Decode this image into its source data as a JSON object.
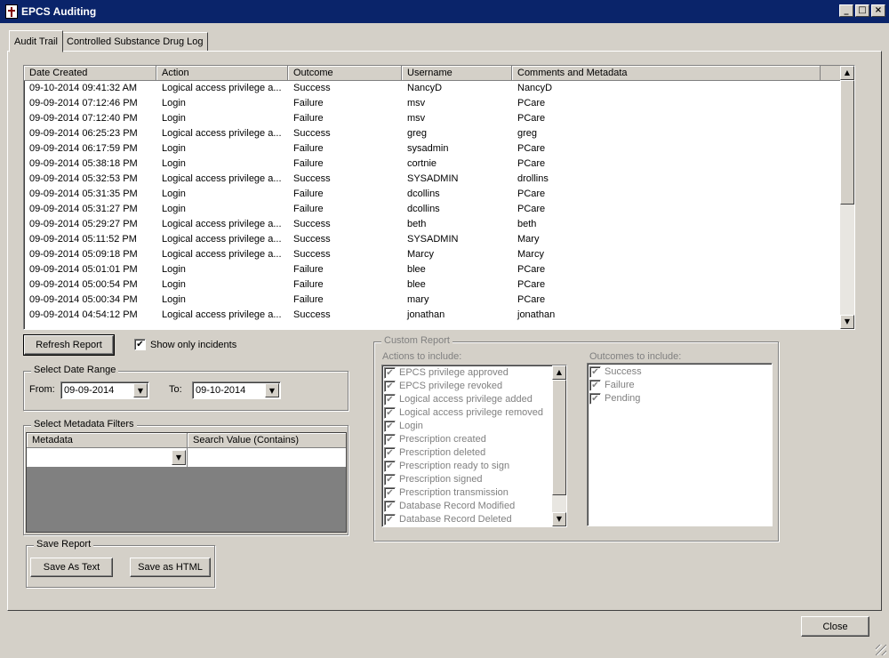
{
  "window": {
    "title": "EPCS Auditing",
    "controls": {
      "minimize": "_",
      "maximize": "□",
      "close": "×"
    }
  },
  "tabs": [
    {
      "label": "Audit Trail",
      "active": true
    },
    {
      "label": "Controlled Substance Drug Log",
      "active": false
    }
  ],
  "grid": {
    "columns": [
      "Date Created",
      "Action",
      "Outcome",
      "Username",
      "Comments and Metadata"
    ],
    "rows": [
      [
        "09-10-2014 09:41:32 AM",
        "Logical access privilege a...",
        "Success",
        "NancyD",
        "NancyD"
      ],
      [
        "09-09-2014 07:12:46 PM",
        "Login",
        "Failure",
        "msv",
        "PCare"
      ],
      [
        "09-09-2014 07:12:40 PM",
        "Login",
        "Failure",
        "msv",
        "PCare"
      ],
      [
        "09-09-2014 06:25:23 PM",
        "Logical access privilege a...",
        "Success",
        "greg",
        "greg"
      ],
      [
        "09-09-2014 06:17:59 PM",
        "Login",
        "Failure",
        "sysadmin",
        "PCare"
      ],
      [
        "09-09-2014 05:38:18 PM",
        "Login",
        "Failure",
        "cortnie",
        "PCare"
      ],
      [
        "09-09-2014 05:32:53 PM",
        "Logical access privilege a...",
        "Success",
        "SYSADMIN",
        "drollins"
      ],
      [
        "09-09-2014 05:31:35 PM",
        "Login",
        "Failure",
        "dcollins",
        "PCare"
      ],
      [
        "09-09-2014 05:31:27 PM",
        "Login",
        "Failure",
        "dcollins",
        "PCare"
      ],
      [
        "09-09-2014 05:29:27 PM",
        "Logical access privilege a...",
        "Success",
        "beth",
        "beth"
      ],
      [
        "09-09-2014 05:11:52 PM",
        "Logical access privilege a...",
        "Success",
        "SYSADMIN",
        "Mary"
      ],
      [
        "09-09-2014 05:09:18 PM",
        "Logical access privilege a...",
        "Success",
        "Marcy",
        "Marcy"
      ],
      [
        "09-09-2014 05:01:01 PM",
        "Login",
        "Failure",
        "blee",
        "PCare"
      ],
      [
        "09-09-2014 05:00:54 PM",
        "Login",
        "Failure",
        "blee",
        "PCare"
      ],
      [
        "09-09-2014 05:00:34 PM",
        "Login",
        "Failure",
        "mary",
        "PCare"
      ],
      [
        "09-09-2014 04:54:12 PM",
        "Logical access privilege a...",
        "Success",
        "jonathan",
        "jonathan"
      ]
    ]
  },
  "controls": {
    "refresh_label": "Refresh Report",
    "show_incidents_label": "Show only incidents",
    "show_incidents_checked": true
  },
  "date_range": {
    "title": "Select Date Range",
    "from_label": "From:",
    "from_value": "09-09-2014",
    "to_label": "To:",
    "to_value": "09-10-2014"
  },
  "metadata_filters": {
    "title": "Select Metadata Filters",
    "col_metadata": "Metadata",
    "col_search": "Search Value (Contains)"
  },
  "save_report": {
    "title": "Save Report",
    "text_label": "Save As Text",
    "html_label": "Save as HTML"
  },
  "custom_report": {
    "title": "Custom Report",
    "actions_label": "Actions to include:",
    "actions": [
      "EPCS privilege approved",
      "EPCS privilege revoked",
      "Logical access privilege added",
      "Logical access privilege removed",
      "Login",
      "Prescription created",
      "Prescription deleted",
      "Prescription ready to sign",
      "Prescription signed",
      "Prescription transmission",
      "Database Record Modified",
      "Database Record Deleted"
    ],
    "outcomes_label": "Outcomes to include:",
    "outcomes": [
      "Success",
      "Failure",
      "Pending"
    ]
  },
  "footer": {
    "close_label": "Close"
  }
}
